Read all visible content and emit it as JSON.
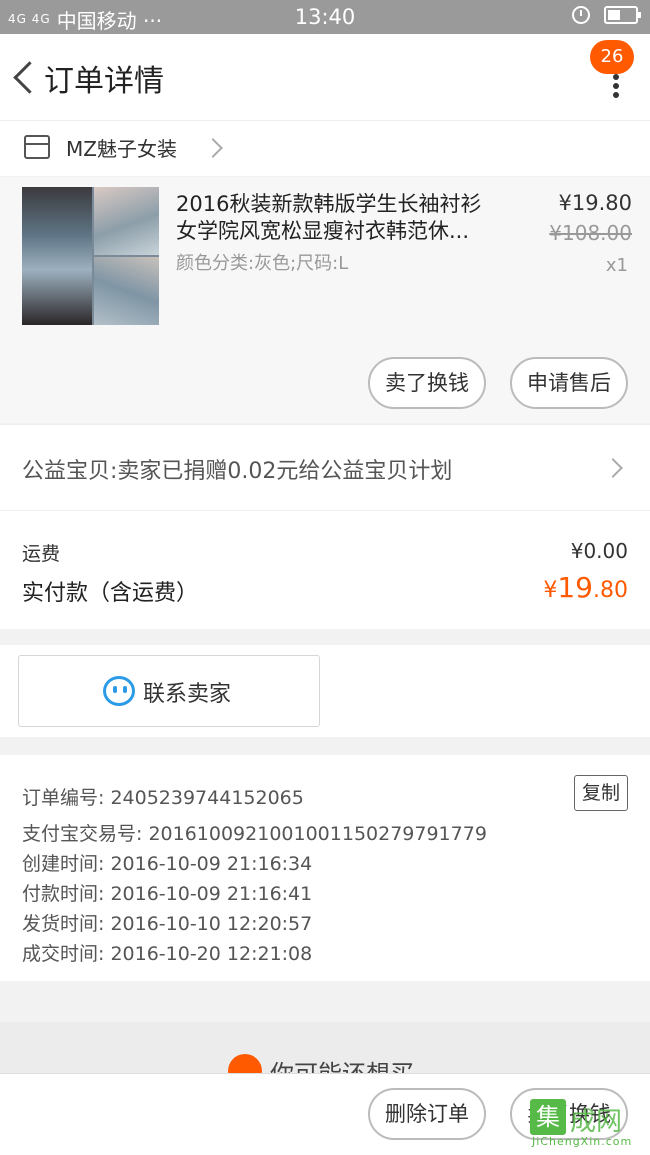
{
  "status_bar": {
    "signal": "4G 4G",
    "carrier": "中国移动 ···",
    "time": "13:40",
    "icons": [
      "alarm-icon",
      "battery-icon"
    ]
  },
  "nav": {
    "title": "订单详情",
    "badge": "26",
    "icons": [
      "back-icon",
      "more-icon"
    ]
  },
  "shop": {
    "name": "MZ魅子女装"
  },
  "item": {
    "title_line1": "2016秋装新款韩版学生长袖衬衫",
    "title_line2": "女学院风宽松显瘦衬衣韩范休...",
    "attributes": "颜色分类:灰色;尺码:L",
    "price": "¥19.80",
    "original_price": "¥108.00",
    "quantity": "x1",
    "buttons": {
      "resell": "卖了换钱",
      "after_sale": "申请售后"
    }
  },
  "charity": {
    "text": "公益宝贝:卖家已捐赠0.02元给公益宝贝计划"
  },
  "totals": {
    "shipping_label": "运费",
    "shipping_value": "¥0.00",
    "paid_label": "实付款（含运费）",
    "paid_currency": "¥",
    "paid_integer": "19",
    "paid_decimal": ".80"
  },
  "contact": {
    "label": "联系卖家"
  },
  "order_info": {
    "order_no": "订单编号: 2405239744152065",
    "alipay_no": "支付宝交易号: 2016100921001001150279791779",
    "created": "创建时间: 2016-10-09 21:16:34",
    "paid": "付款时间: 2016-10-09 21:16:41",
    "shipped": "发货时间: 2016-10-10 12:20:57",
    "completed": "成交时间: 2016-10-20 12:21:08",
    "copy_label": "复制"
  },
  "recommend": {
    "text": "你可能还想买"
  },
  "bottom_bar": {
    "delete_label": "删除订单",
    "resell_label": "卖了换钱"
  },
  "watermark": {
    "char": "集",
    "text": "成网",
    "sub": "JiChengXin.com"
  },
  "colors": {
    "accent": "#ff5a00",
    "contact_blue": "#2b9be8"
  }
}
